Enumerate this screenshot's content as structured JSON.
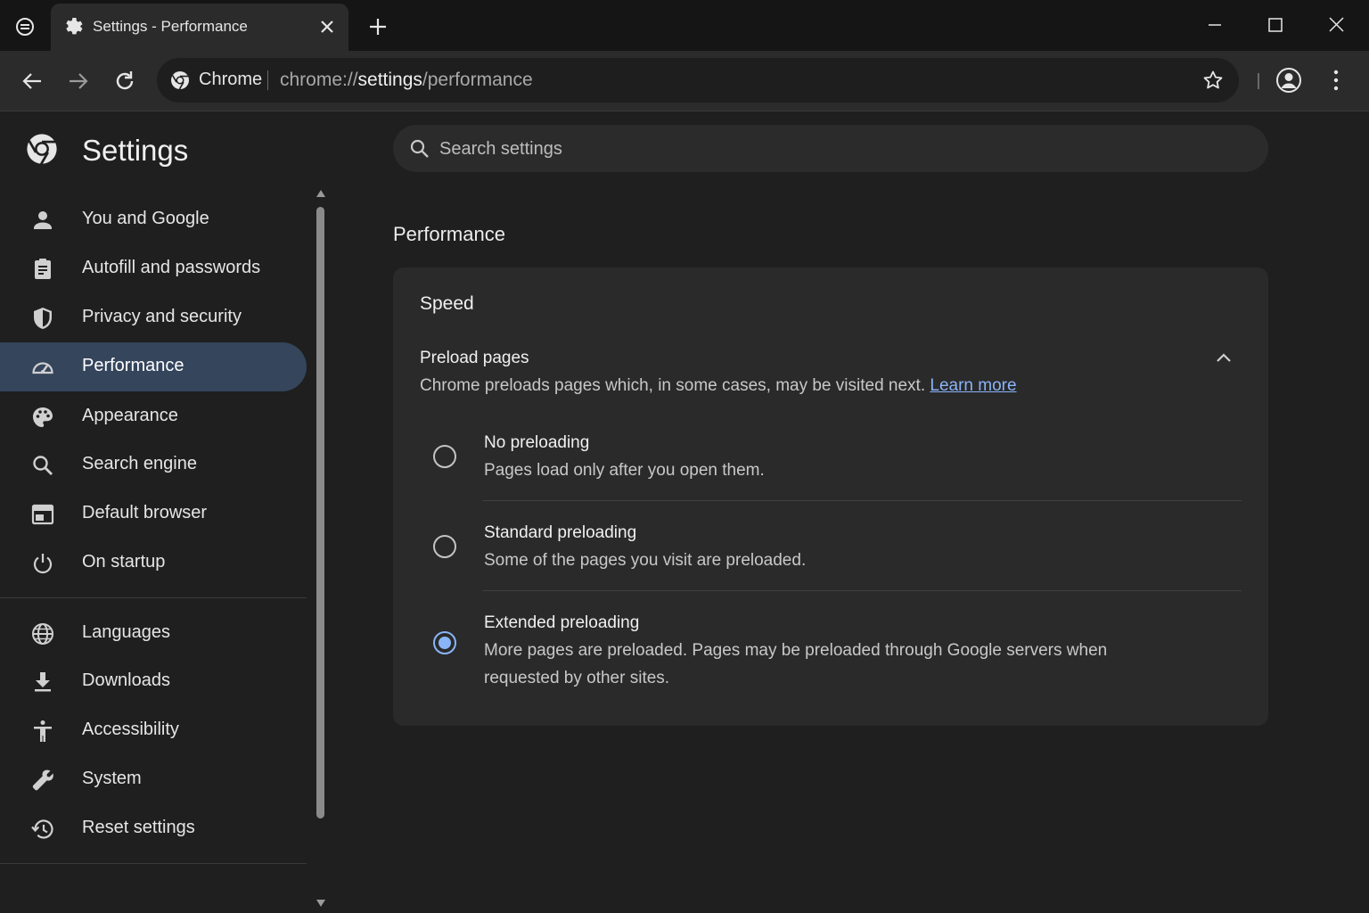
{
  "window": {
    "tab_title": "Settings - Performance",
    "minimize_icon": "minimize-icon",
    "maximize_icon": "maximize-icon",
    "close_icon": "close-icon"
  },
  "toolbar": {
    "chip_label": "Chrome",
    "url_scheme": "chrome://",
    "url_host": "settings",
    "url_path": "/performance"
  },
  "sidebar": {
    "title": "Settings",
    "items": [
      {
        "label": "You and Google",
        "icon": "person-icon"
      },
      {
        "label": "Autofill and passwords",
        "icon": "clipboard-icon"
      },
      {
        "label": "Privacy and security",
        "icon": "shield-icon"
      },
      {
        "label": "Performance",
        "icon": "speedometer-icon",
        "active": true
      },
      {
        "label": "Appearance",
        "icon": "palette-icon"
      },
      {
        "label": "Search engine",
        "icon": "search-icon"
      },
      {
        "label": "Default browser",
        "icon": "browser-window-icon"
      },
      {
        "label": "On startup",
        "icon": "power-icon"
      },
      {
        "label": "Languages",
        "icon": "globe-icon"
      },
      {
        "label": "Downloads",
        "icon": "download-icon"
      },
      {
        "label": "Accessibility",
        "icon": "accessibility-icon"
      },
      {
        "label": "System",
        "icon": "wrench-icon"
      },
      {
        "label": "Reset settings",
        "icon": "history-icon"
      }
    ]
  },
  "search": {
    "placeholder": "Search settings"
  },
  "main": {
    "section_title": "Performance",
    "card": {
      "heading": "Speed",
      "preload_title": "Preload pages",
      "preload_desc": "Chrome preloads pages which, in some cases, may be visited next.",
      "learn_more": "Learn more",
      "options": [
        {
          "title": "No preloading",
          "desc": "Pages load only after you open them.",
          "checked": false
        },
        {
          "title": "Standard preloading",
          "desc": "Some of the pages you visit are preloaded.",
          "checked": false
        },
        {
          "title": "Extended preloading",
          "desc": "More pages are preloaded. Pages may be preloaded through Google servers when requested by other sites.",
          "checked": true
        }
      ]
    }
  },
  "colors": {
    "accent": "#8ab4f8",
    "active_nav": "#34455c",
    "background": "#1f1f1f",
    "card": "#2a2a2a"
  }
}
